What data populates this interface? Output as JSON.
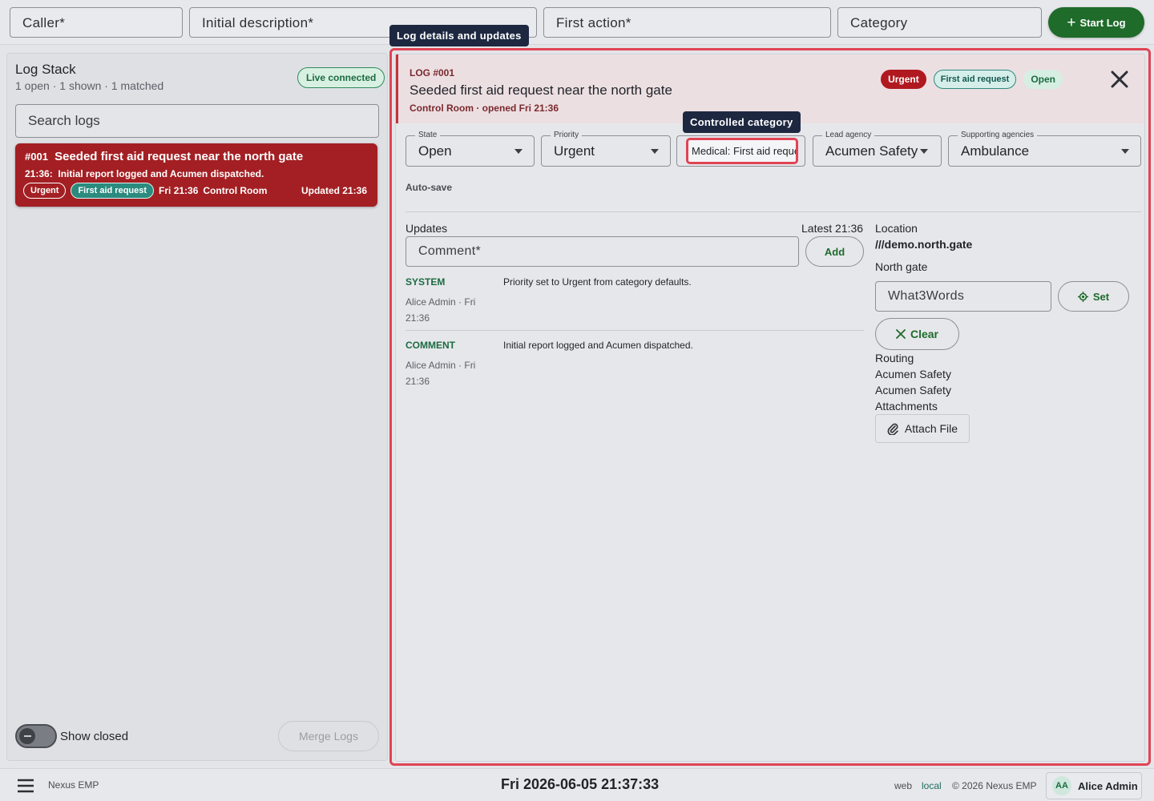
{
  "topbar": {
    "caller_placeholder": "Caller*",
    "initial_description_placeholder": "Initial description*",
    "first_action_placeholder": "First action*",
    "category_placeholder": "Category",
    "start_log_label": "Start Log"
  },
  "log_stack": {
    "title": "Log Stack",
    "summary": "1 open · 1 shown · 1 matched",
    "live_badge": "Live connected",
    "search_placeholder": "Search logs",
    "logs": [
      {
        "number": "#001",
        "title": "Seeded first aid request near the north gate",
        "time": "21:36:",
        "description": "Initial report logged and Acumen dispatched.",
        "priority": "Urgent",
        "category": "First aid request",
        "opened": "Fri 21:36",
        "source": "Control Room",
        "updated": "Updated 21:36"
      }
    ],
    "show_closed_label": "Show closed",
    "merge_logs_label": "Merge Logs"
  },
  "detail": {
    "tooltip": "Log details and updates",
    "log_id": "LOG #001",
    "title": "Seeded first aid request near the north gate",
    "meta": "Control Room · opened Fri 21:36",
    "badges": {
      "priority": "Urgent",
      "category": "First aid request",
      "state": "Open"
    },
    "fields": {
      "state_label": "State",
      "state_value": "Open",
      "priority_label": "Priority",
      "priority_value": "Urgent",
      "category_tooltip": "Controlled category",
      "category_value": "Medical: First aid request",
      "lead_agency_label": "Lead agency",
      "lead_agency_value": "Acumen Safety",
      "supporting_label": "Supporting agencies",
      "supporting_value": "Ambulance"
    },
    "autosave": "Auto-save",
    "updates": {
      "label": "Updates",
      "latest": "Latest 21:36",
      "comment_placeholder": "Comment*",
      "add_label": "Add",
      "entries": [
        {
          "type": "SYSTEM",
          "author": "Alice Admin · Fri 21:36",
          "message": "Priority set to Urgent from category defaults."
        },
        {
          "type": "COMMENT",
          "author": "Alice Admin · Fri 21:36",
          "message": "Initial report logged and Acumen dispatched."
        }
      ]
    },
    "location": {
      "label": "Location",
      "w3w": "///demo.north.gate",
      "name": "North gate",
      "w3w_placeholder": "What3Words",
      "set_label": "Set",
      "clear_label": "Clear",
      "routing_label": "Routing",
      "routing": [
        "Acumen Safety",
        "Acumen Safety"
      ],
      "attachments_label": "Attachments",
      "attach_label": "Attach File"
    }
  },
  "footer": {
    "brand": "Nexus EMP",
    "clock": "Fri 2026-06-05 21:37:33",
    "env_web": "web",
    "env_local": "local",
    "copyright": "© 2026 Nexus EMP",
    "user_initials": "AA",
    "user_name": "Alice Admin"
  },
  "colors": {
    "urgent_red": "#a31f23",
    "accent_green": "#1e6b2a",
    "highlight_outline": "#e04454",
    "tooltip_bg": "#1d2840"
  }
}
